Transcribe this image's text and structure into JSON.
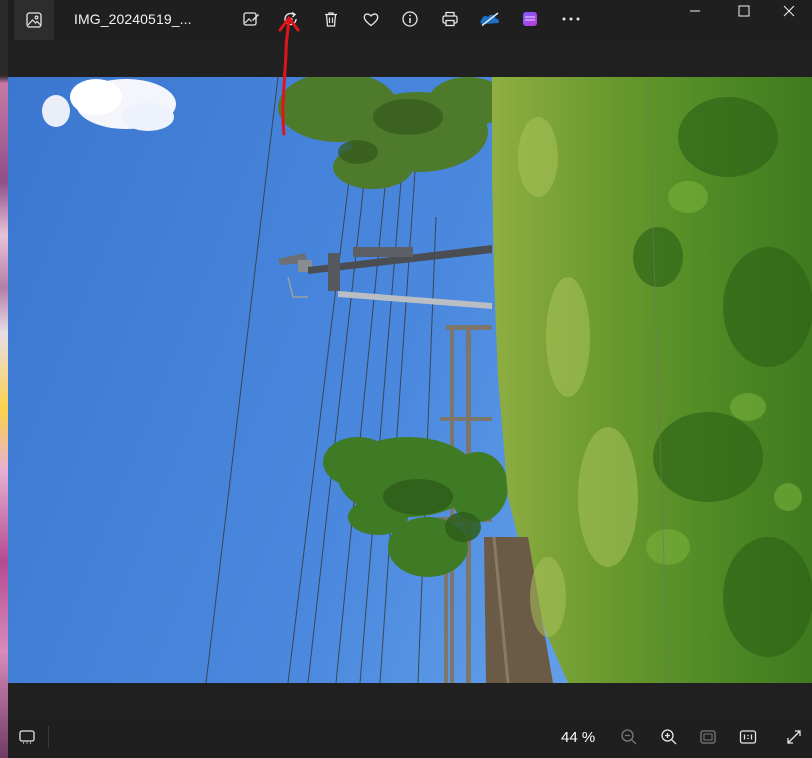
{
  "window": {
    "filename": "IMG_20240519_..."
  },
  "toolbar": {
    "buttons": [
      {
        "name": "edit-image-icon",
        "label": "Edit image"
      },
      {
        "name": "rotate-icon",
        "label": "Rotate"
      },
      {
        "name": "delete-icon",
        "label": "Delete"
      },
      {
        "name": "favorite-icon",
        "label": "Add to favorites"
      },
      {
        "name": "info-icon",
        "label": "File information"
      },
      {
        "name": "print-icon",
        "label": "Print"
      },
      {
        "name": "onedrive-icon",
        "label": "OneDrive"
      },
      {
        "name": "clipchamp-icon",
        "label": "Clipchamp"
      },
      {
        "name": "more-icon",
        "label": "See more"
      }
    ]
  },
  "window_controls": [
    "minimize",
    "maximize",
    "close"
  ],
  "annotation": {
    "type": "arrow",
    "color": "#e0141a",
    "points_to": "rotate-icon"
  },
  "statusbar": {
    "zoom": "44 %",
    "buttons": [
      "filmstrip-icon",
      "zoom-out-icon",
      "zoom-in-icon",
      "fit-to-window-icon",
      "actual-size-icon",
      "fullscreen-icon"
    ]
  },
  "colors": {
    "background": "#1f1f1f",
    "text": "#f2f2f2",
    "accent_annotation": "#e0141a"
  }
}
